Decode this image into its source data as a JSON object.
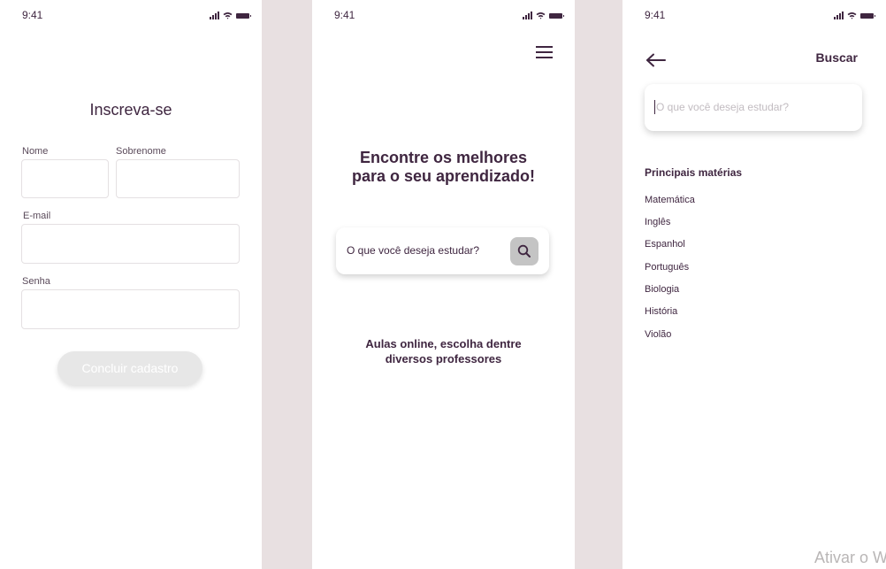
{
  "colors": {
    "primary_text": "#3f2640",
    "background": "#e8e0e1",
    "disabled_button": "#e7e7e7"
  },
  "status_bar": {
    "time": "9:41",
    "icons": [
      "signal-icon",
      "wifi-icon",
      "battery-icon"
    ]
  },
  "signup": {
    "title": "Inscreva-se",
    "first_name_label": "Nome",
    "last_name_label": "Sobrenome",
    "email_label": "E-mail",
    "password_label": "Senha",
    "submit_label": "Concluir cadastro"
  },
  "home": {
    "menu_icon": "hamburger-menu-icon",
    "headline_line1": "Encontre os melhores",
    "headline_line2": "para o seu aprendizado!",
    "search_text": "O que você deseja estudar?",
    "search_icon": "search-icon",
    "subtitle_line1": "Aulas online, escolha dentre",
    "subtitle_line2": "diversos professores"
  },
  "search": {
    "back_icon": "arrow-left-icon",
    "action_label": "Buscar",
    "placeholder": "O que você deseja estudar?",
    "section_title": "Principais matérias",
    "subjects": [
      "Matemática",
      "Inglês",
      "Espanhol",
      "Português",
      "Biologia",
      "História",
      "Violão"
    ]
  },
  "watermark": "Ativar o W"
}
